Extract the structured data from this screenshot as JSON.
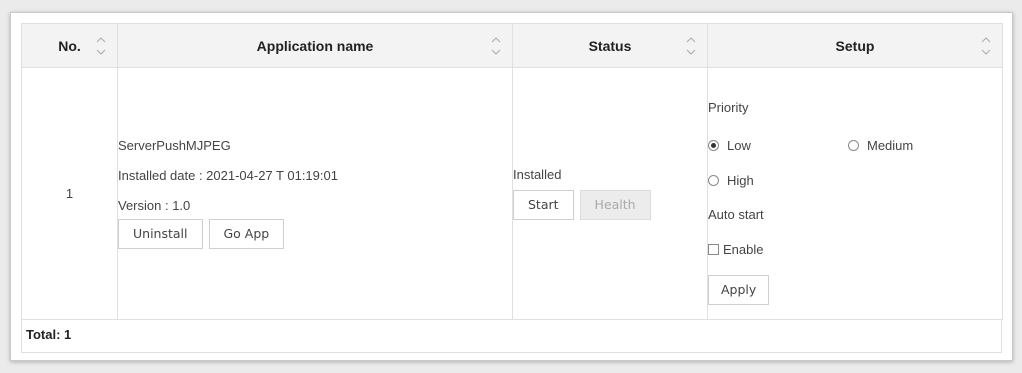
{
  "table": {
    "columns": [
      {
        "label": "No."
      },
      {
        "label": "Application name"
      },
      {
        "label": "Status"
      },
      {
        "label": "Setup"
      }
    ],
    "rows": [
      {
        "no": "1",
        "app_name": "ServerPushMJPEG",
        "installed_date": "Installed date : 2021-04-27 T 01:19:01",
        "version": "Version : 1.0",
        "uninstall_label": "Uninstall",
        "go_app_label": "Go App",
        "status": "Installed",
        "start_label": "Start",
        "health_label": "Health",
        "setup": {
          "priority_label": "Priority",
          "priority_options": [
            "Low",
            "Medium",
            "High"
          ],
          "priority_selected": "Low",
          "auto_start_label": "Auto start",
          "enable_label": "Enable",
          "enable_checked": false,
          "apply_label": "Apply"
        }
      }
    ]
  },
  "footer": {
    "total": "Total: 1"
  },
  "icons": {
    "sort": "sort-icon"
  }
}
